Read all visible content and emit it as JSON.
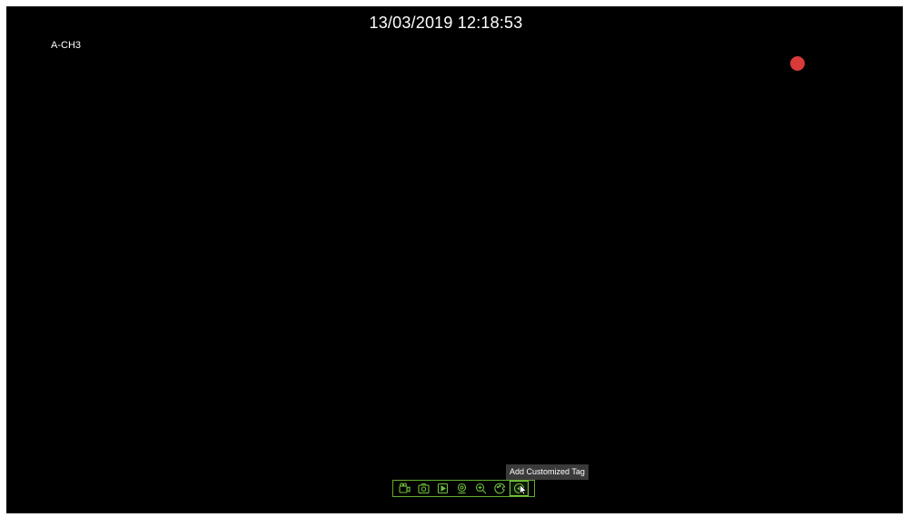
{
  "overlay": {
    "timestamp": "13/03/2019 12:18:53",
    "channel": "A-CH3",
    "recording_indicator_color": "#d93a3a"
  },
  "toolbar": {
    "accent_color": "#5fae2e",
    "tools": [
      {
        "icon": "record-icon"
      },
      {
        "icon": "snapshot-icon"
      },
      {
        "icon": "playback-icon"
      },
      {
        "icon": "ptz-icon"
      },
      {
        "icon": "zoom-icon"
      },
      {
        "icon": "color-adjust-icon"
      },
      {
        "icon": "add-tag-icon"
      }
    ],
    "active_tool": "add-tag-icon"
  },
  "tooltip": {
    "text": "Add Customized Tag"
  }
}
